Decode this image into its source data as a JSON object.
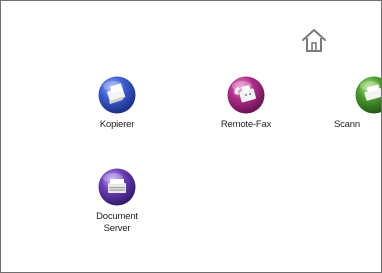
{
  "home": {
    "icon": "home-icon"
  },
  "apps": [
    {
      "label": "Kopierer",
      "icon": "copier-icon",
      "color": "#3f5fd0"
    },
    {
      "label": "Remote-Fax",
      "icon": "fax-icon",
      "color": "#b0318a"
    },
    {
      "label": "Scann",
      "icon": "scanner-icon",
      "color": "#4b9b2e"
    },
    {
      "label": "Document Server",
      "label_line1": "Document",
      "label_line2": "Server",
      "icon": "document-server-icon",
      "color": "#6a3fb5"
    }
  ]
}
